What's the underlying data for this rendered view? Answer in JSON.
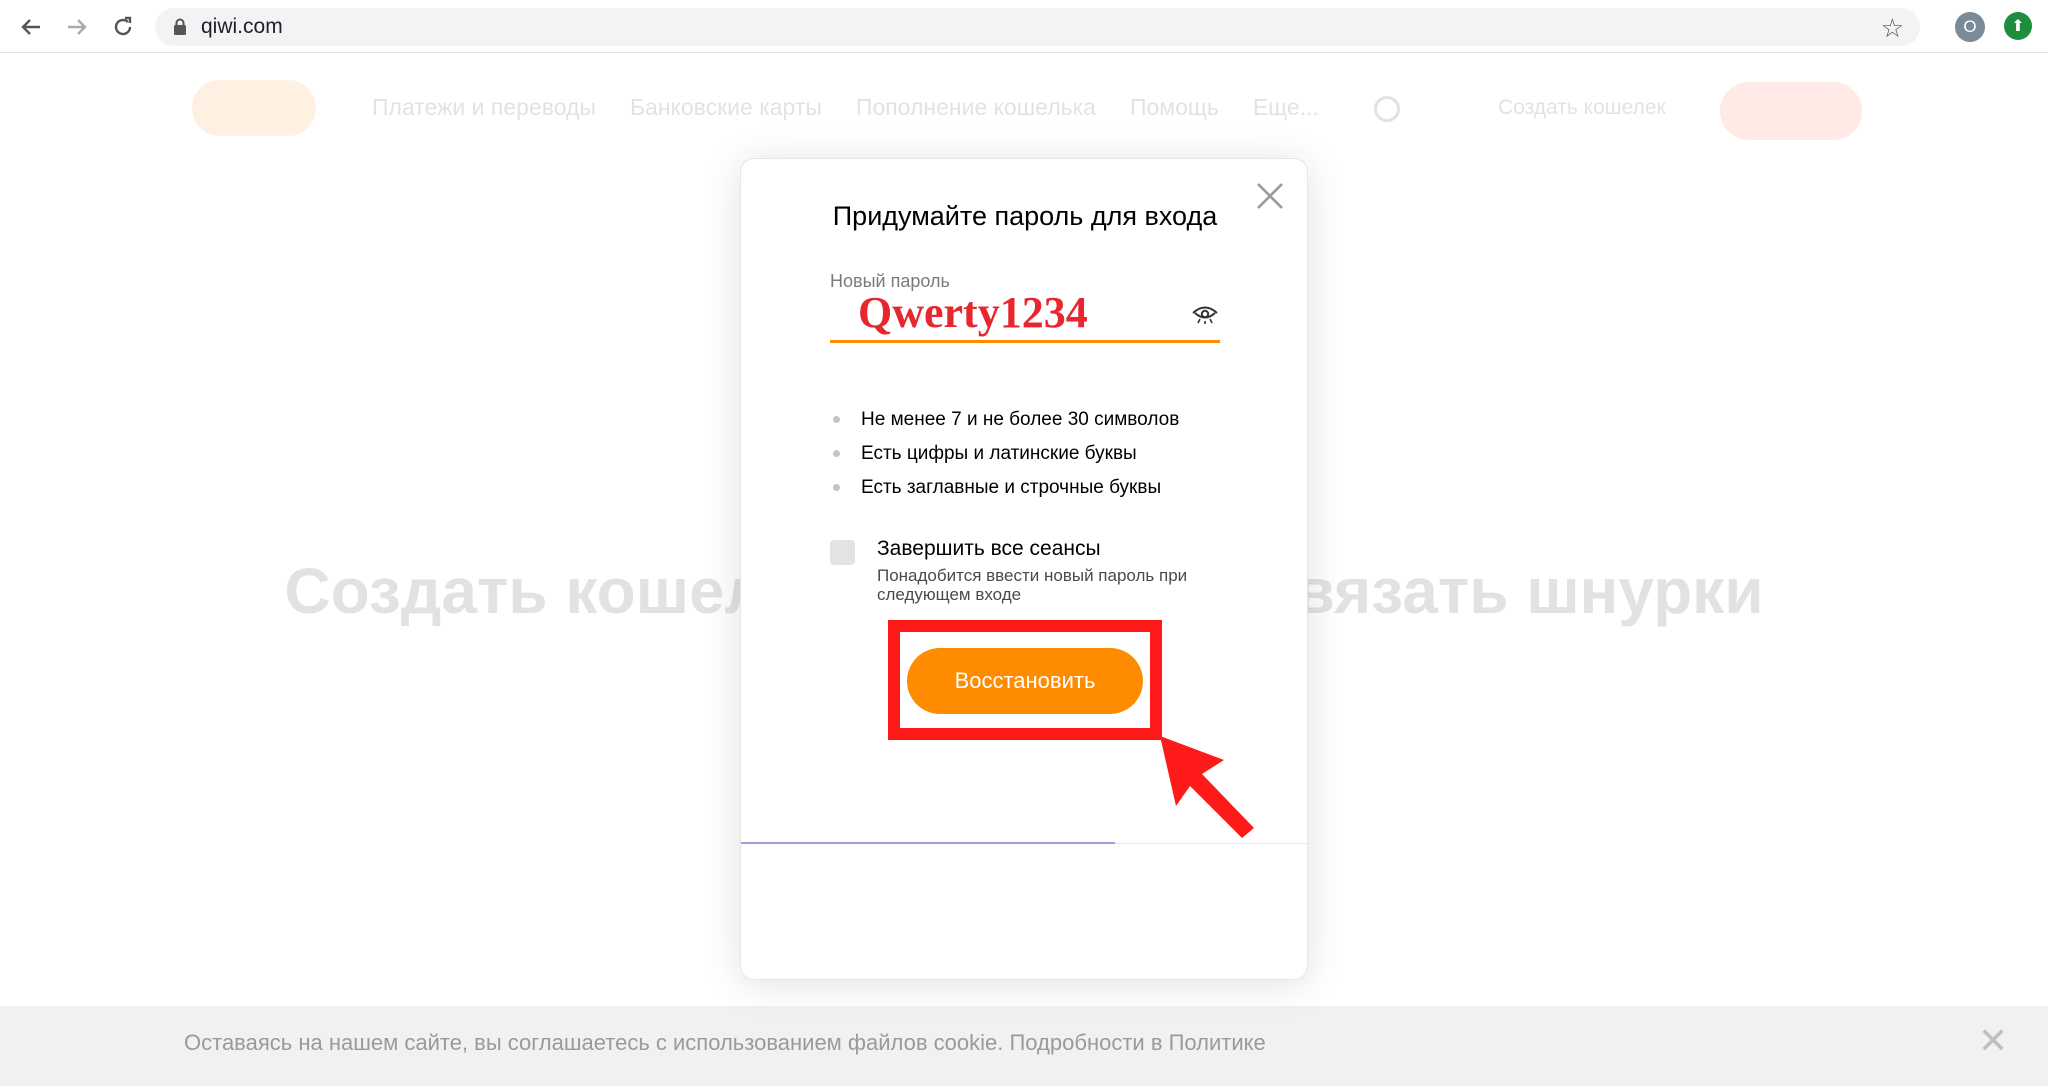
{
  "browser": {
    "url": "qiwi.com",
    "profile_initial": "O",
    "icons": {
      "back": "arrow-left-icon",
      "forward": "arrow-right-icon",
      "reload": "reload-icon",
      "lock": "lock-icon",
      "bookmark": "star-icon",
      "extension": "arrow-up-circle-icon"
    }
  },
  "background_page": {
    "nav": [
      "Платежи и переводы",
      "Банковские карты",
      "Пополнение кошелька",
      "Помощь",
      "Еще..."
    ],
    "create_wallet": "Создать кошелек",
    "hero": "Создать кошелек проще, чем завязать шнурки",
    "cookie_notice": "Оставаясь на нашем сайте, вы соглашаетесь с использованием файлов cookie. Подробности в Политике"
  },
  "modal": {
    "title": "Придумайте пароль для входа",
    "password_label": "Новый пароль",
    "password_value": "Qwerty1234",
    "rules": [
      "Не менее 7 и не более 30 символов",
      "Есть цифры и латинские буквы",
      "Есть заглавные и строчные буквы"
    ],
    "end_sessions": {
      "title": "Завершить все сеансы",
      "hint": "Понадобится ввести новый пароль при следующем входе",
      "checked": false
    },
    "submit_label": "Восстановить"
  },
  "colors": {
    "accent": "#ff8c00",
    "annotation": "#ff1a1a",
    "password_text": "#e8262e"
  }
}
